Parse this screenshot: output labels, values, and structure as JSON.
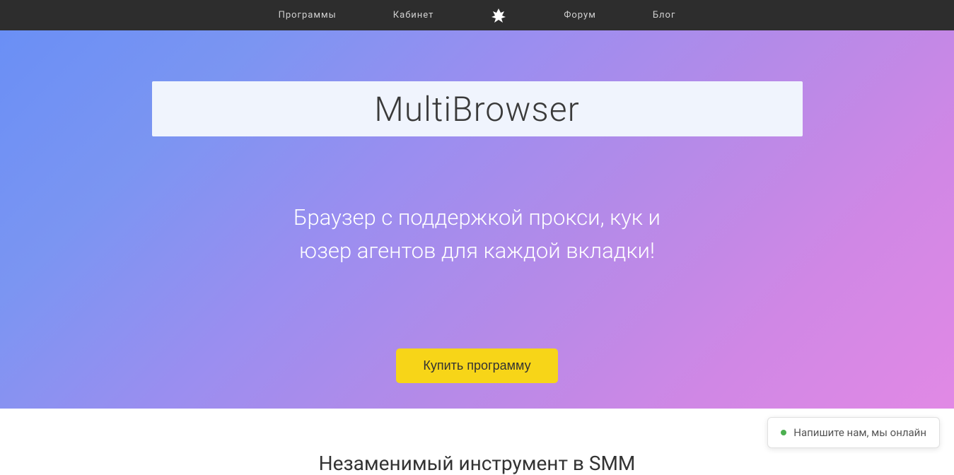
{
  "nav": {
    "items": [
      "Программы",
      "Кабинет",
      "Форум",
      "Блог"
    ]
  },
  "hero": {
    "title": "MultiBrowser",
    "subtitle_line1": "Браузер с поддержкой прокси, кук и",
    "subtitle_line2": "юзер агентов для каждой вкладки!",
    "buy_button": "Купить программу"
  },
  "section": {
    "heading": "Незаменимый инструмент в SMM"
  },
  "chat": {
    "text": "Напишите нам, мы онлайн"
  }
}
